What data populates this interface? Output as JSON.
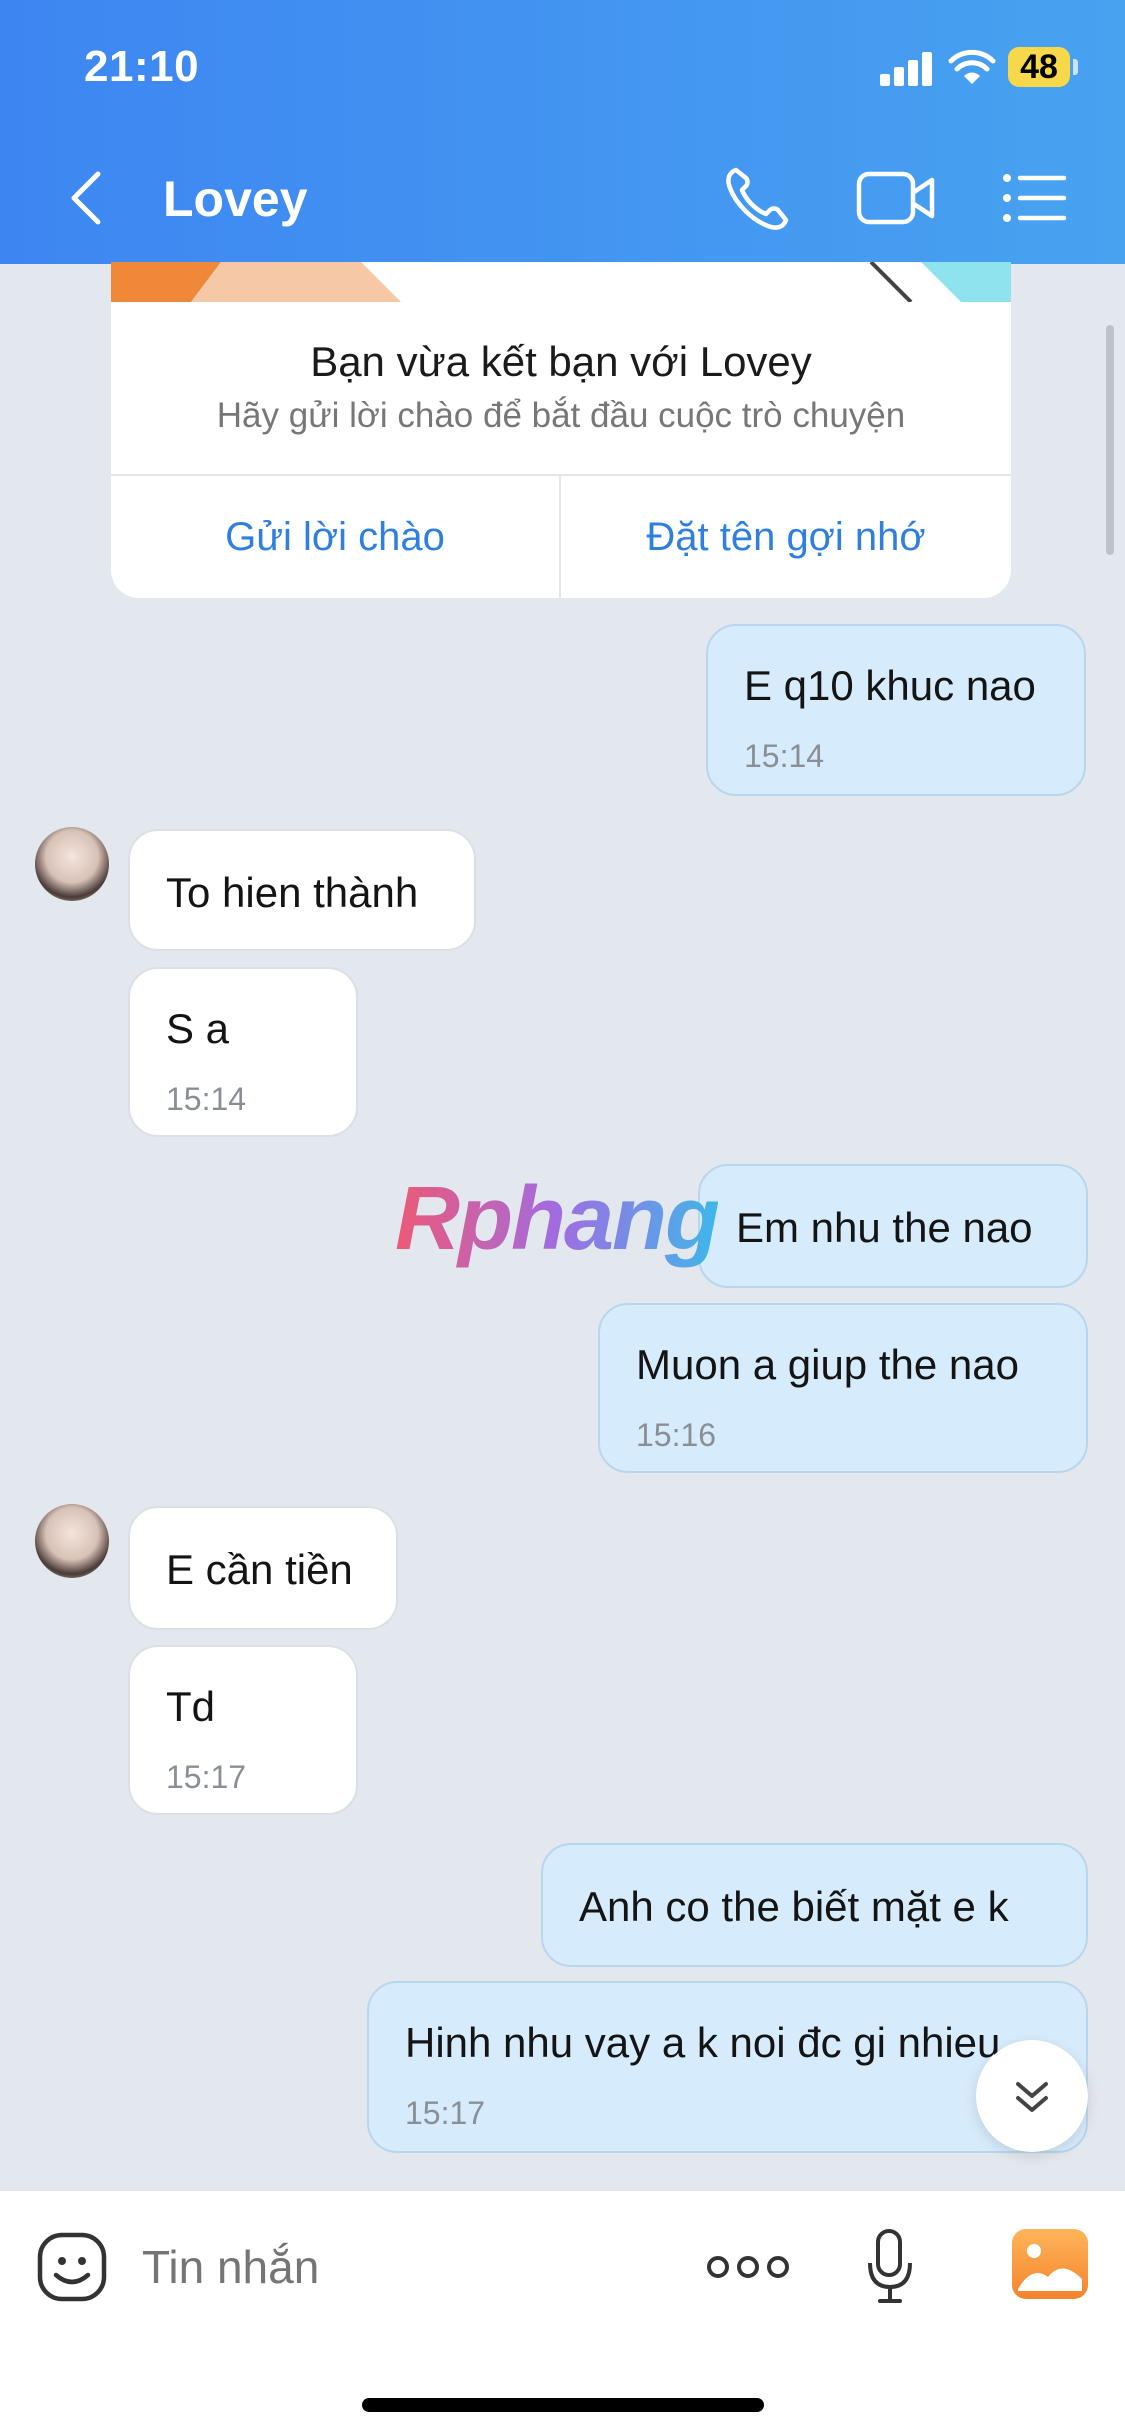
{
  "status": {
    "time": "21:10",
    "battery": "48"
  },
  "header": {
    "title": "Lovey"
  },
  "friend_card": {
    "title": "Bạn vừa kết bạn với Lovey",
    "subtitle": "Hãy gửi lời chào để bắt đầu cuộc trò chuyện",
    "greet_button": "Gửi lời chào",
    "nickname_button": "Đặt tên gợi nhớ"
  },
  "messages": [
    {
      "dir": "out",
      "text": "E q10 khuc nao",
      "time": "15:14"
    },
    {
      "dir": "in",
      "text": "To hien thành"
    },
    {
      "dir": "in",
      "text": "S a",
      "time": "15:14"
    },
    {
      "dir": "out",
      "text": "Em nhu the nao"
    },
    {
      "dir": "out",
      "text": "Muon a giup the nao",
      "time": "15:16"
    },
    {
      "dir": "in",
      "text": "E cần tiền"
    },
    {
      "dir": "in",
      "text": "Td",
      "time": "15:17"
    },
    {
      "dir": "out",
      "text": "Anh co the biết mặt e k"
    },
    {
      "dir": "out",
      "text": "Hinh nhu vay a k noi đc gi nhieu",
      "time": "15:17"
    }
  ],
  "watermark": "Rphang",
  "composer": {
    "placeholder": "Tin nhắn"
  }
}
